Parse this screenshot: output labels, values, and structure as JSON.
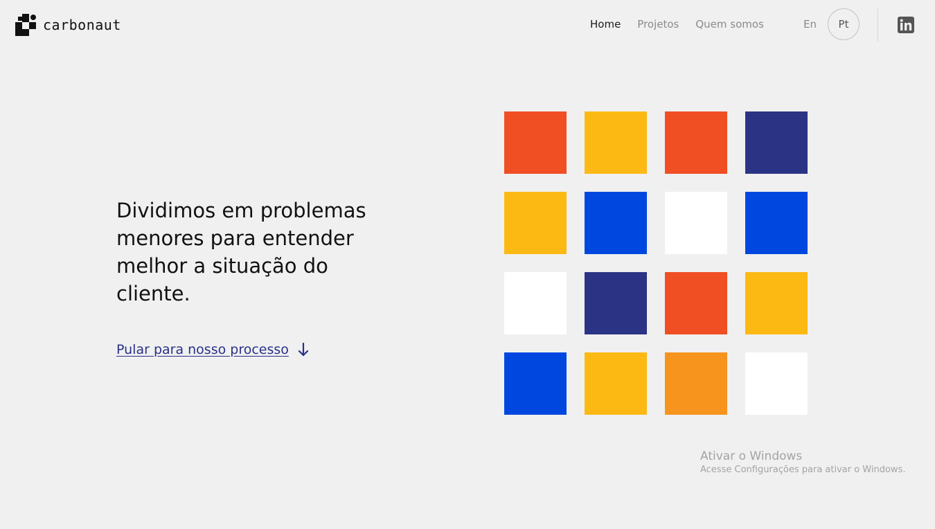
{
  "brand": {
    "name": "carbonaut"
  },
  "nav": {
    "items": [
      {
        "label": "Home",
        "active": true
      },
      {
        "label": "Projetos",
        "active": false
      },
      {
        "label": "Quem somos",
        "active": false
      }
    ]
  },
  "language": {
    "en_label": "En",
    "pt_label": "Pt",
    "selected": "Pt"
  },
  "social": {
    "icon": "linkedin-icon"
  },
  "hero": {
    "headline": "Dividimos em problemas menores para entender melhor a situação do cliente.",
    "link_label": "Pular para nosso processo",
    "link_icon": "arrow-down-icon"
  },
  "colors": {
    "background": "#f0f0f0",
    "red": "#f04e23",
    "yellow": "#fdb913",
    "navy": "#2b3385",
    "blue": "#0047e0",
    "white": "#ffffff",
    "orange": "#f7941d",
    "link": "#29308a"
  },
  "tiles": [
    [
      "red",
      "yellow",
      "red",
      "navy"
    ],
    [
      "yellow",
      "blue",
      "white",
      "blue"
    ],
    [
      "white",
      "navy",
      "red",
      "yellow"
    ],
    [
      "blue",
      "yellow",
      "orange",
      "white"
    ]
  ],
  "watermark": {
    "title": "Ativar o Windows",
    "subtitle": "Acesse Configurações para ativar o Windows."
  }
}
